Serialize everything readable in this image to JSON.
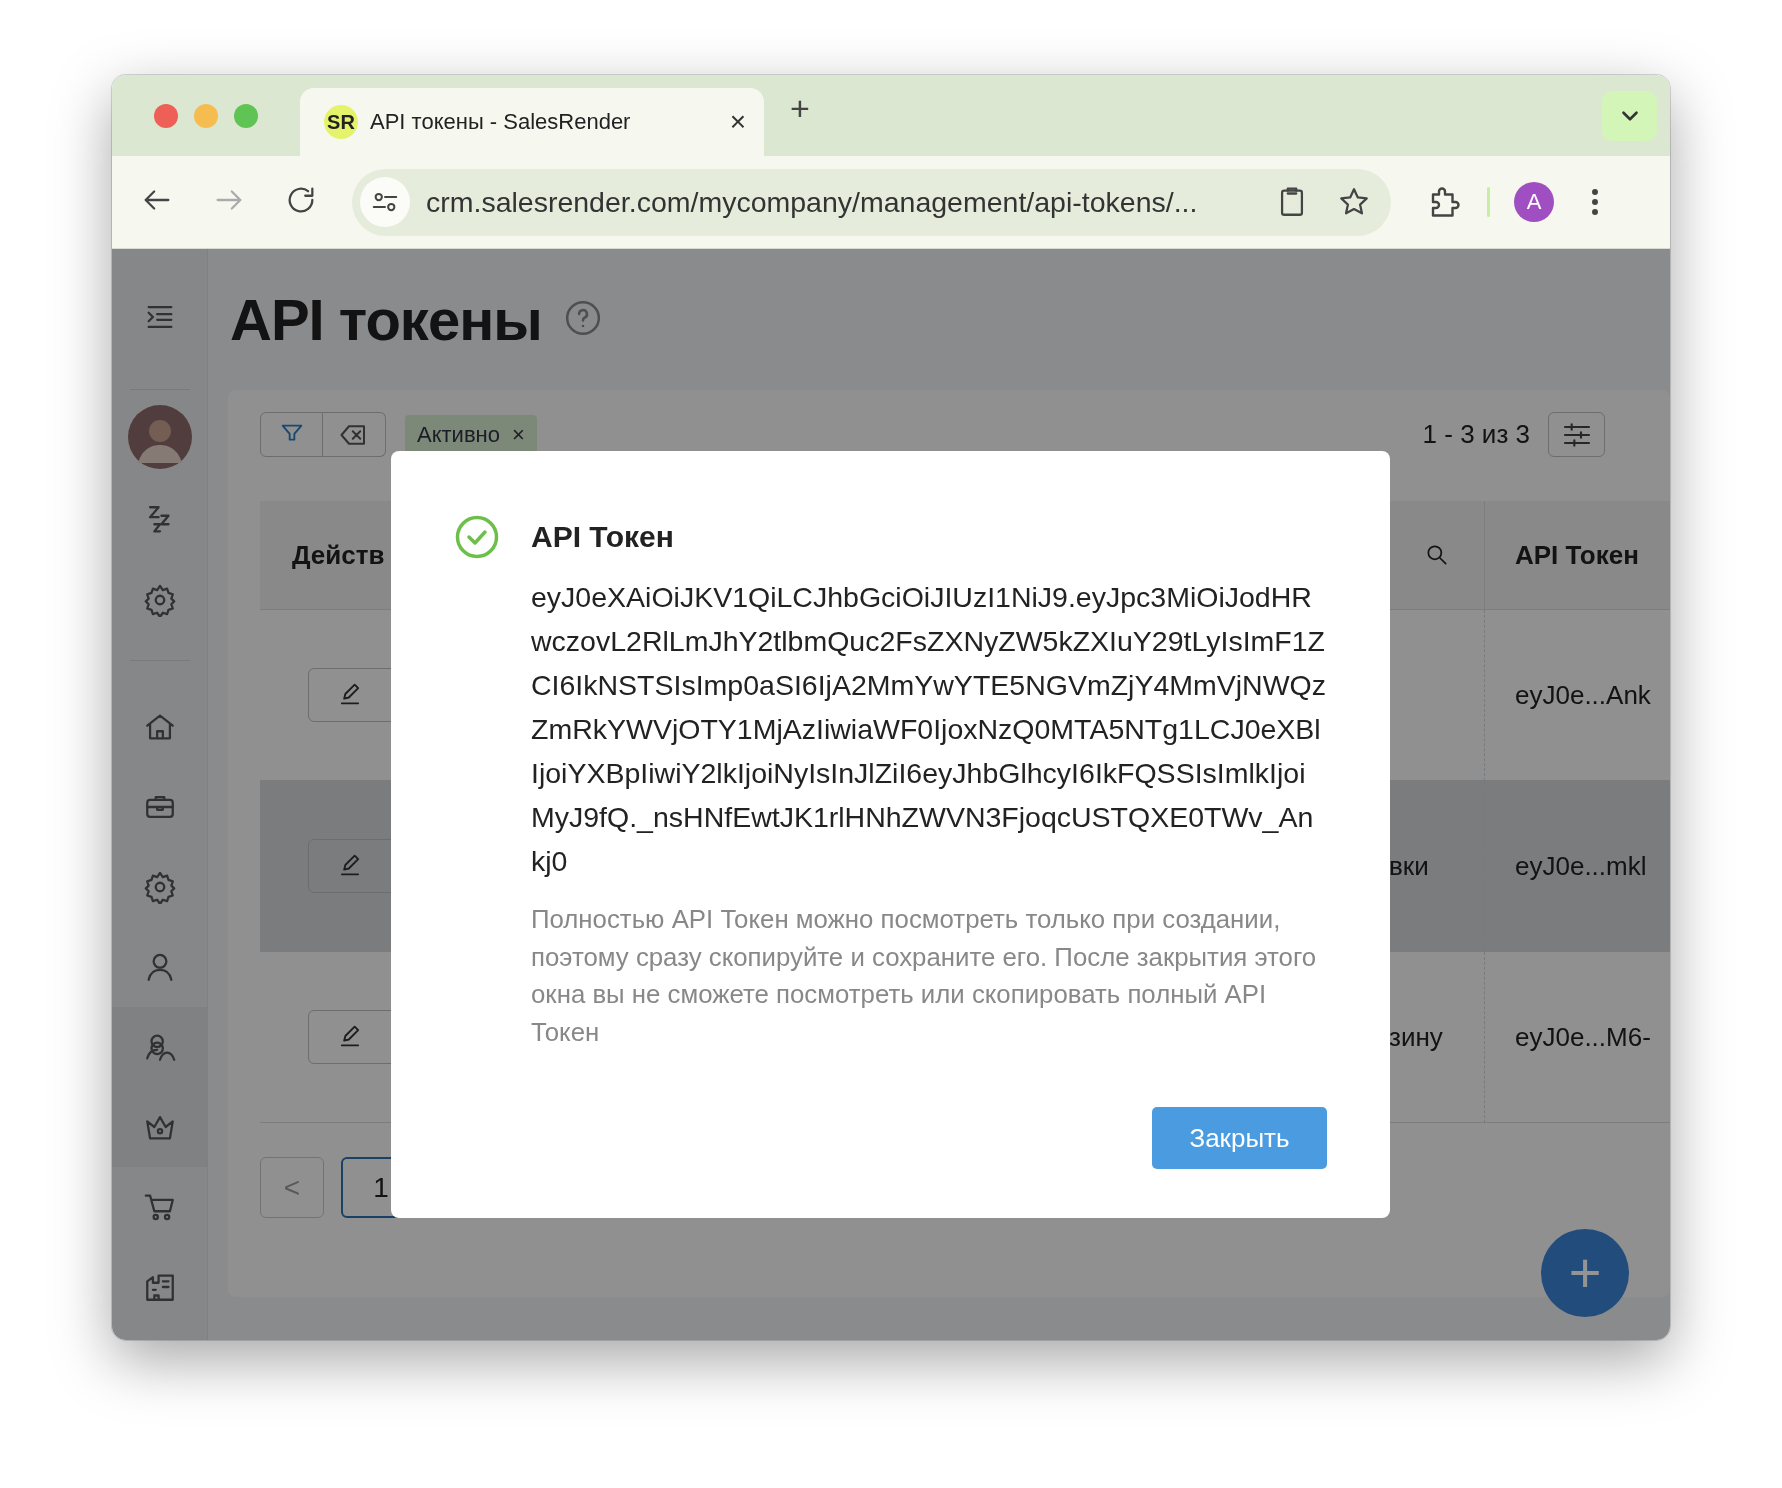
{
  "browser": {
    "tab": {
      "favicon": "SR",
      "title": "API токены - SalesRender",
      "close": "×",
      "selected": true
    },
    "new_tab": "+",
    "url": "crm.salesrender.com/mycompany/management/api-tokens/...",
    "profile": "A"
  },
  "page": {
    "title": "API токены"
  },
  "filters": {
    "chip": {
      "label": "Активно",
      "remove": "×"
    },
    "range": "1 - 3 из 3"
  },
  "table": {
    "columns": [
      {
        "label": "Действ"
      },
      {
        "label": "API Токен"
      }
    ],
    "rows": [
      {
        "highlighted": false,
        "token": "eyJ0e...Ank"
      },
      {
        "highlighted": true,
        "column_3": "вки",
        "token": "eyJ0e...mkl"
      },
      {
        "highlighted": false,
        "column_3": "зину",
        "token": "eyJ0e...M6-"
      }
    ]
  },
  "pagination": {
    "prev": "<",
    "pages": [
      {
        "label": "1",
        "selected": true
      }
    ]
  },
  "fab": "+",
  "modal": {
    "title": "API Токен",
    "token": "eyJ0eXAiOiJKV1QiLCJhbGciOiJIUzI1NiJ9.eyJpc3MiOiJodHRwczovL2RlLmJhY2tlbmQuc2FsZXNyZW5kZXIuY29tLyIsImF1ZCI6IkNSTSIsImp0aSI6IjA2MmYwYTE5NGVmZjY4MmVjNWQzZmRkYWVjOTY1MjAzIiwiaWF0IjoxNzQ0MTA5NTg1LCJ0eXBlIjoiYXBpIiwiY2lkIjoiNyIsInJlZiI6eyJhbGlhcyI6IkFQSSIsImlkIjoiMyJ9fQ._nsHNfEwtJK1rlHNhZWVN3FjoqcUSTQXE0TWv_Ankj0",
    "note": "Полностью API Токен можно посмотреть только при создании, поэтому сразу скопируйте и сохраните его. После закрытия этого окна вы не сможете посмотреть или скопировать полный API Токен",
    "button": "Закрыть"
  }
}
